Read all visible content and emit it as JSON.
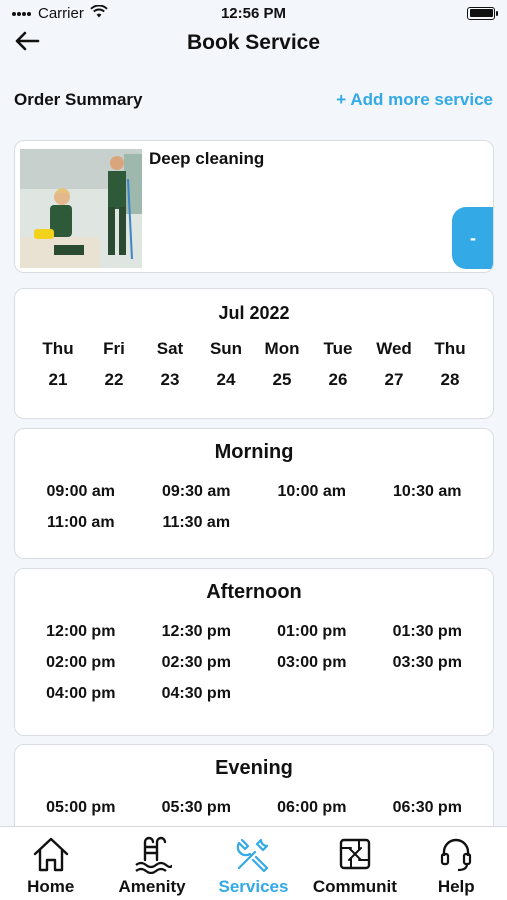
{
  "status_bar": {
    "carrier": "Carrier",
    "time": "12:56 PM"
  },
  "header": {
    "title": "Book Service"
  },
  "summary": {
    "title": "Order Summary",
    "add_more": "+ Add more service"
  },
  "service": {
    "name": "Deep cleaning",
    "decrement": "-"
  },
  "calendar": {
    "month": "Jul 2022",
    "days": [
      {
        "name": "Thu",
        "num": "21"
      },
      {
        "name": "Fri",
        "num": "22"
      },
      {
        "name": "Sat",
        "num": "23"
      },
      {
        "name": "Sun",
        "num": "24"
      },
      {
        "name": "Mon",
        "num": "25"
      },
      {
        "name": "Tue",
        "num": "26"
      },
      {
        "name": "Wed",
        "num": "27"
      },
      {
        "name": "Thu",
        "num": "28"
      }
    ]
  },
  "morning": {
    "title": "Morning",
    "slots": [
      "09:00 am",
      "09:30 am",
      "10:00 am",
      "10:30 am",
      "11:00 am",
      "11:30 am"
    ]
  },
  "afternoon": {
    "title": "Afternoon",
    "slots": [
      "12:00 pm",
      "12:30 pm",
      "01:00 pm",
      "01:30 pm",
      "02:00 pm",
      "02:30 pm",
      "03:00 pm",
      "03:30 pm",
      "04:00 pm",
      "04:30 pm"
    ]
  },
  "evening": {
    "title": "Evening",
    "slots": [
      "05:00 pm",
      "05:30 pm",
      "06:00 pm",
      "06:30 pm"
    ]
  },
  "tabs": [
    {
      "label": "Home",
      "icon": "home-icon"
    },
    {
      "label": "Amenity",
      "icon": "pool-ladder-icon"
    },
    {
      "label": "Services",
      "icon": "tools-icon"
    },
    {
      "label": "Communit",
      "icon": "community-hands-icon"
    },
    {
      "label": "Help",
      "icon": "headset-icon"
    }
  ],
  "colors": {
    "accent": "#33a9e6",
    "background": "#f3f6fa",
    "card": "#ffffff"
  }
}
